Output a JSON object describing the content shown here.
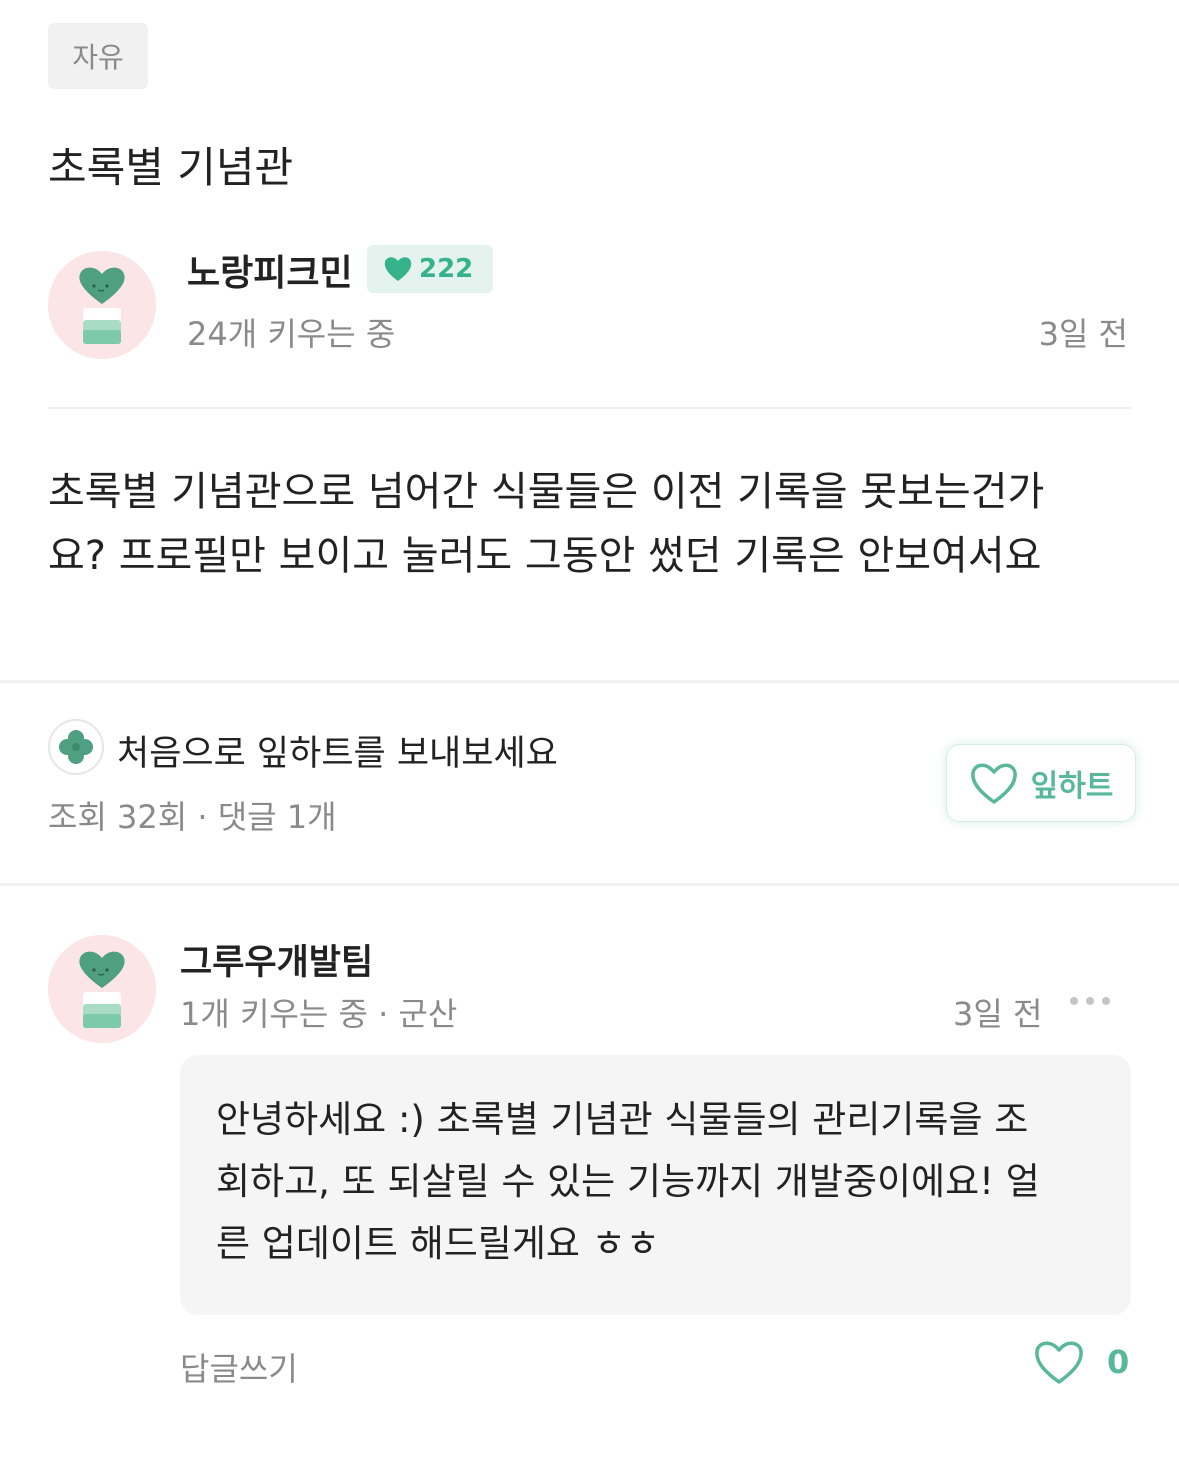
{
  "post": {
    "category": "자유",
    "title": "초록별 기념관",
    "author": {
      "name": "노랑피크민",
      "leaf_count": "222",
      "meta": "24개 키우는 중",
      "time": "3일 전"
    },
    "body_line1": "초록별 기념관으로 넘어간 식물들은 이전 기록을 못보는건가",
    "body_line2": "요? 프로필만 보이고 눌러도 그동안 썼던 기록은 안보여서요"
  },
  "reactions": {
    "send_prompt": "처음으로 잎하트를 보내보세요",
    "stats": "조회 32회 · 댓글 1개",
    "leafheart_label": "잎하트"
  },
  "comment": {
    "author": "그루우개발팀",
    "meta": "1개 키우는 중 · 군산",
    "time": "3일 전",
    "text_line1": "안녕하세요 :) 초록별 기념관 식물들의 관리기록을 조",
    "text_line2": "회하고,  또 되살릴 수 있는 기능까지 개발중이에요! 얼",
    "text_line3": "른 업데이트 해드릴게요 ㅎㅎ",
    "reply_label": "답글쓰기",
    "like_count": "0"
  },
  "colors": {
    "accent": "#36b38a",
    "accent_soft": "#5ab89a",
    "badge_bg": "#e4f3ee",
    "avatar_bg": "#fbe5e6",
    "muted_text": "#8a8a8a"
  },
  "icons": {
    "author_avatar": "plant-pot-avatar-icon",
    "badge": "leaf-heart-icon",
    "clover": "clover-icon",
    "leafheart": "heart-outline-icon",
    "more": "more-dots-icon"
  }
}
